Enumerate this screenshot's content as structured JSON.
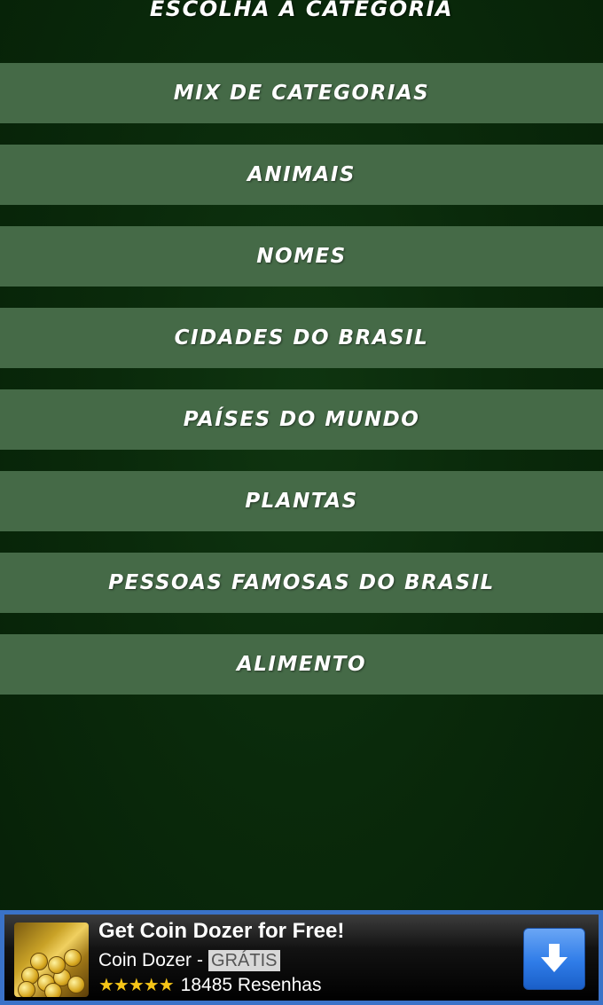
{
  "header": {
    "title": "ESCOLHA A CATEGORIA"
  },
  "categories": [
    {
      "label": "MIX DE CATEGORIAS"
    },
    {
      "label": "ANIMAIS"
    },
    {
      "label": "NOMES"
    },
    {
      "label": "CIDADES DO BRASIL"
    },
    {
      "label": "PAÍSES DO MUNDO"
    },
    {
      "label": "PLANTAS"
    },
    {
      "label": "PESSOAS FAMOSAS DO BRASIL"
    },
    {
      "label": "ALIMENTO"
    }
  ],
  "ad": {
    "title": "Get Coin Dozer for Free!",
    "app_name": "Coin Dozer",
    "separator": "-",
    "price": "GRÁTIS",
    "stars_text": "★★★★★",
    "rating": 4.5,
    "reviews": "18485 Resenhas",
    "thumbnail_icon": "coin-dozer-app-icon",
    "button_icon": "download-arrow-icon"
  },
  "colors": {
    "background": "#0a2a0b",
    "category_button": "#456a47",
    "ad_border": "#3a72c8",
    "download_button": "#2f7ce8",
    "stars": "#f5c518"
  }
}
